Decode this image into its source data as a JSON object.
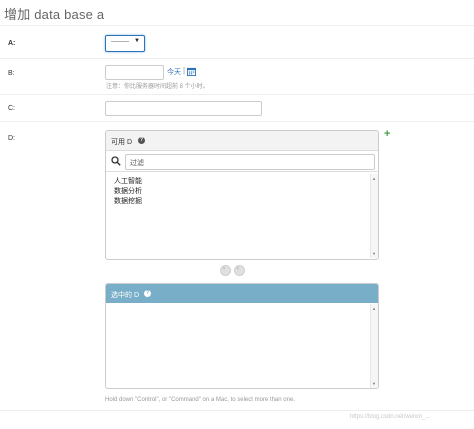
{
  "page": {
    "title": "增加 data base a"
  },
  "fields": {
    "a": {
      "label": "A:",
      "select_value": "---------"
    },
    "b": {
      "label": "B:",
      "today_link": "今天",
      "separator": "|",
      "help": "注意：你比服务器时间超前 8 个小时。"
    },
    "c": {
      "label": "C:"
    },
    "d": {
      "label": "D:",
      "available": {
        "title": "可用 D",
        "filter_placeholder": "过滤",
        "options": [
          "人工智能",
          "数据分析",
          "数据挖掘"
        ]
      },
      "chosen": {
        "title": "选中的 D"
      },
      "help": "Hold down \"Control\", or \"Command\" on a Mac, to select more than one."
    }
  },
  "icons": {
    "help": "?",
    "add": "+",
    "calendar": "calendar-icon",
    "search": "search-icon"
  },
  "colors": {
    "accent": "#2d73b8",
    "chosen_header": "#79aec8",
    "add_green": "#44a144"
  },
  "watermark": "https://blog.csdn.net/weixin_..."
}
